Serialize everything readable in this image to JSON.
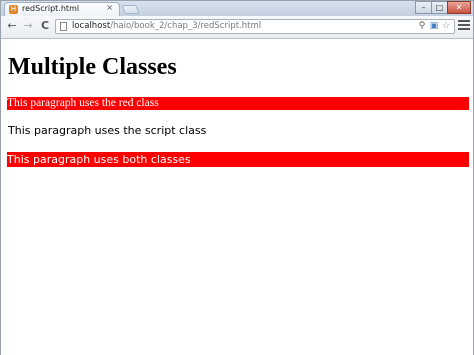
{
  "browser": {
    "tab": {
      "title": "redScript.html",
      "favicon": "html-file-icon"
    },
    "address_bar": {
      "host": "localhost",
      "path": "/haio/book_2/chap_3/redScript.html"
    },
    "window_controls": {
      "minimize": "–",
      "maximize": "□",
      "close": "✕"
    },
    "nav": {
      "back": "←",
      "forward": "→",
      "reload": "C"
    },
    "tab_close": "×"
  },
  "page": {
    "heading": "Multiple Classes",
    "paragraphs": [
      {
        "text": "This paragraph uses the red class"
      },
      {
        "text": "This paragraph uses the script class"
      },
      {
        "text": "This paragraph uses both classes"
      }
    ]
  },
  "colors": {
    "red_class_background": "#ff0000",
    "red_class_text": "#ffffff"
  }
}
